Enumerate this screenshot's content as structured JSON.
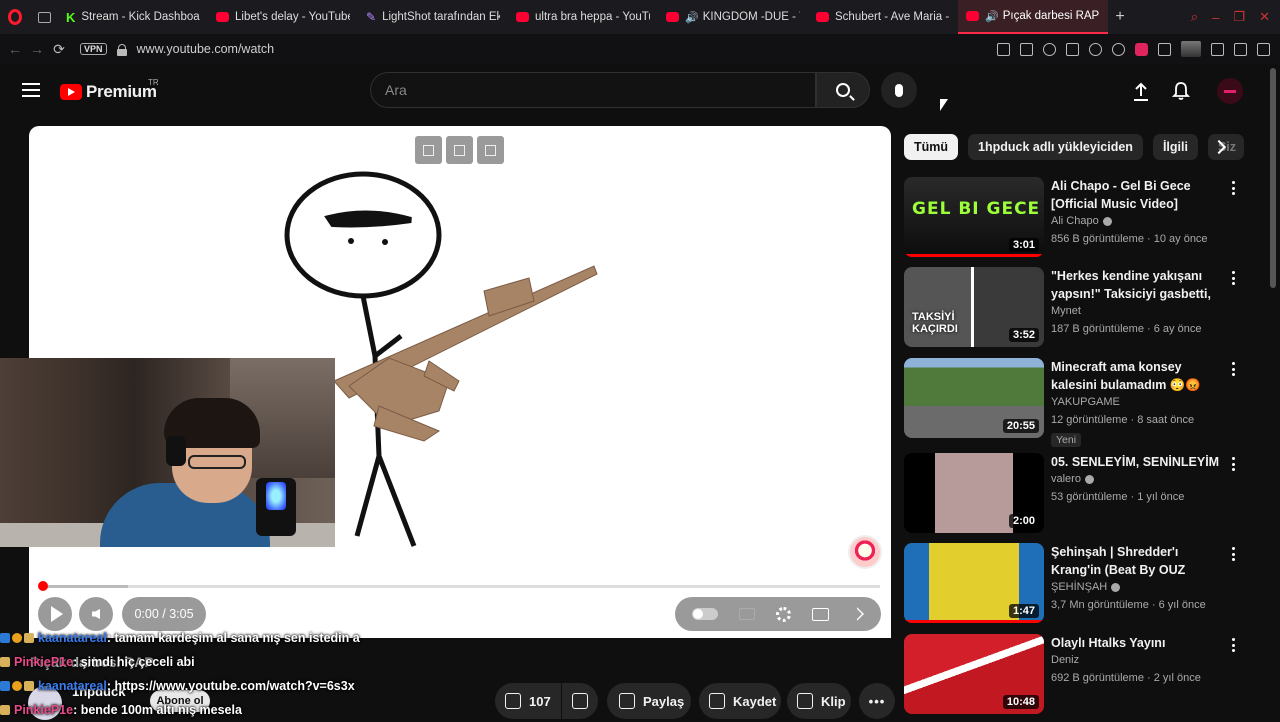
{
  "browser": {
    "tabs": [
      {
        "label": "Stream - Kick Dashboard",
        "icon": "kick-icon"
      },
      {
        "label": "Libet's delay - YouTube",
        "icon": "youtube-icon"
      },
      {
        "label": "LightShot tarafından Ekra",
        "icon": "feather-icon"
      },
      {
        "label": "ultra bra heppa - YouTub",
        "icon": "youtube-icon"
      },
      {
        "label": "KINGDOM -DUE - Yo",
        "icon": "youtube-icon"
      },
      {
        "label": "Schubert - Ave Maria - Y",
        "icon": "youtube-icon"
      },
      {
        "label": "Pıçak darbesi RAP - Yo",
        "icon": "youtube-icon",
        "active": true
      }
    ],
    "vpn_label": "VPN",
    "url": "www.youtube.com/watch"
  },
  "header": {
    "logo_text": "Premium",
    "region": "TR",
    "search_placeholder": "Ara"
  },
  "player": {
    "time": "0:00 / 3:05",
    "progress": 0
  },
  "chat": [
    {
      "user": "kaanatareal",
      "message": ": tamam kardeşim al sana nış sen istedin a"
    },
    {
      "user": "PinkieP1e",
      "message": ": şimdi hiç çeceli abi"
    },
    {
      "user": "kaanatareal",
      "message": ": https://www.youtube.com/watch?v=6s3x"
    },
    {
      "user": "PinkieP1e",
      "message": ": bende 100m altı nış mesela"
    }
  ],
  "video": {
    "title": "Pıçak darbesi RAP",
    "channel": "1hpduck",
    "subscribe_label": "Abone ol"
  },
  "actions": {
    "like_count": "107",
    "share_label": "Paylaş",
    "save_label": "Kaydet",
    "clip_label": "Klip",
    "more_label": "•••"
  },
  "chips": [
    "Tümü",
    "1hpduck adlı yükleyiciden",
    "İlgili",
    "Siz"
  ],
  "recommendations": [
    {
      "title": "Ali Chapo - Gel Bi Gece [Official Music Video]",
      "channel": "Ali Chapo",
      "verified": true,
      "views": "856 B görüntüleme",
      "age": "10 ay önce",
      "duration": "3:01",
      "thumb_text": "GEL BI GECE",
      "watched": true
    },
    {
      "title": "\"Herkes kendine yakışanı yapsın!\" Taksiciyi gasbetti, ara...",
      "channel": "Mynet",
      "verified": false,
      "views": "187 B görüntüleme",
      "age": "6 ay önce",
      "duration": "3:52",
      "thumb_text": "TAKSİYİ KAÇIRDI",
      "watched": false
    },
    {
      "title": "Minecraft ama konsey kalesini bulamadım 😳😡",
      "channel": "YAKUPGAME",
      "verified": false,
      "views": "12 görüntüleme",
      "age": "8 saat önce",
      "duration": "20:55",
      "badge": "Yeni",
      "thumb_text": "",
      "watched": false
    },
    {
      "title": "05. SENLEYİM, SENİNLEYİM",
      "channel": "valero",
      "verified": true,
      "views": "53 görüntüleme",
      "age": "1 yıl önce",
      "duration": "2:00",
      "thumb_text": "",
      "watched": false
    },
    {
      "title": "Şehinşah | Shredder'ı Krang'in (Beat By OUZ BAYDAR)",
      "channel": "ŞEHİNŞAH",
      "verified": true,
      "views": "3,7 Mn görüntüleme",
      "age": "6 yıl önce",
      "duration": "1:47",
      "thumb_text": "",
      "watched": true
    },
    {
      "title": "Olaylı Htalks Yayını",
      "channel": "Deniz",
      "verified": false,
      "views": "692 B görüntüleme",
      "age": "2 yıl önce",
      "duration": "10:48",
      "thumb_text": "",
      "watched": false
    }
  ],
  "colors": {
    "accent": "#ff0000",
    "background": "#0f0f0f",
    "browser_accent": "#ff1b2d"
  }
}
